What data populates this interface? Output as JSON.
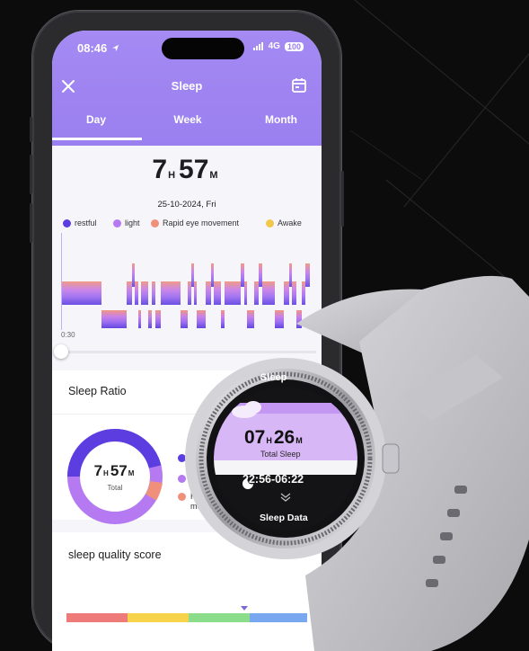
{
  "phone": {
    "status": {
      "time": "08:46",
      "signal": "4G",
      "battery": "100"
    },
    "header": {
      "title": "Sleep"
    },
    "tabs": [
      {
        "label": "Day",
        "active": true
      },
      {
        "label": "Week",
        "active": false
      },
      {
        "label": "Month",
        "active": false
      }
    ],
    "summary": {
      "hours": "7",
      "hours_unit": "H",
      "minutes": "57",
      "minutes_unit": "M",
      "date": "25-10-2024, Fri"
    },
    "legend": [
      {
        "label": "restful",
        "color": "#5b3de0"
      },
      {
        "label": "light",
        "color": "#b57af2"
      },
      {
        "label": "Rapid eye movement",
        "color": "#f0907a"
      },
      {
        "label": "Awake",
        "color": "#f2c84a"
      }
    ],
    "chart": {
      "start_time": "0:30"
    },
    "sleep_ratio": {
      "title": "Sleep Ratio",
      "hours": "7",
      "hours_unit": "H",
      "minutes": "57",
      "minutes_unit": "M",
      "total_label": "Total",
      "legend_visible": [
        "res",
        "ligh",
        "Rap",
        "mo"
      ]
    },
    "quality": {
      "title": "sleep quality score",
      "segments": [
        "#ef7a7a",
        "#f6d34a",
        "#8bdc8b",
        "#7aa8f0"
      ]
    }
  },
  "watch": {
    "title": "Sleep",
    "hours": "07",
    "hours_unit": "H",
    "minutes": "26",
    "minutes_unit": "M",
    "total_label": "Total Sleep",
    "range": "22:56-06:22",
    "chevron": "»",
    "data_label": "Sleep Data"
  },
  "icons": [
    "close-icon",
    "calendar-icon",
    "location-arrow-icon",
    "moon-icon",
    "cloud-icon"
  ]
}
